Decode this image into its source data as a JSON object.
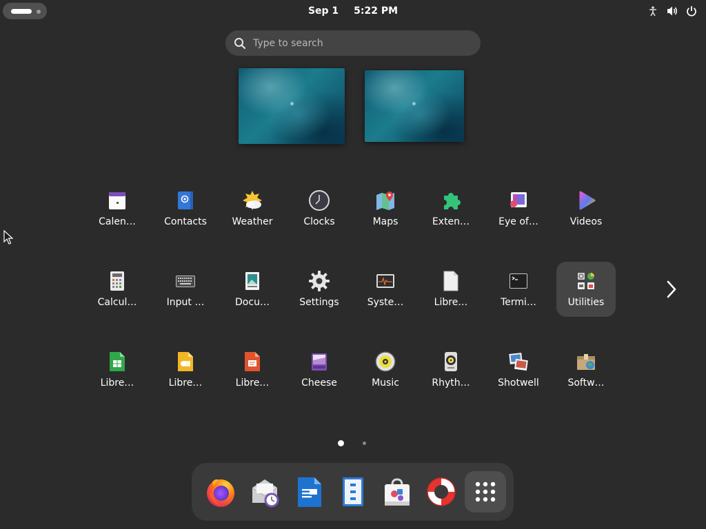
{
  "topbar": {
    "date": "Sep 1",
    "time": "5:22 PM",
    "status_icons": [
      "accessibility-icon",
      "volume-icon",
      "power-icon"
    ]
  },
  "search": {
    "placeholder": "Type to search"
  },
  "workspaces": [
    "workspace-1",
    "workspace-2"
  ],
  "app_grid": {
    "rows": [
      [
        {
          "label": "Calen…",
          "icon": "calendar-icon"
        },
        {
          "label": "Contacts",
          "icon": "contacts-icon"
        },
        {
          "label": "Weather",
          "icon": "weather-icon"
        },
        {
          "label": "Clocks",
          "icon": "clocks-icon"
        },
        {
          "label": "Maps",
          "icon": "maps-icon"
        },
        {
          "label": "Exten…",
          "icon": "extensions-icon"
        },
        {
          "label": "Eye of…",
          "icon": "image-viewer-icon"
        },
        {
          "label": "Videos",
          "icon": "videos-icon"
        }
      ],
      [
        {
          "label": "Calcul…",
          "icon": "calculator-icon"
        },
        {
          "label": "Input …",
          "icon": "keyboard-icon"
        },
        {
          "label": "Docu…",
          "icon": "document-viewer-icon"
        },
        {
          "label": "Settings",
          "icon": "settings-gear-icon"
        },
        {
          "label": "Syste…",
          "icon": "system-monitor-icon"
        },
        {
          "label": "Libre…",
          "icon": "libreoffice-icon"
        },
        {
          "label": "Termi…",
          "icon": "terminal-icon"
        },
        {
          "label": "Utilities",
          "icon": "utilities-folder-icon"
        }
      ],
      [
        {
          "label": "Libre…",
          "icon": "libreoffice-calc-icon"
        },
        {
          "label": "Libre…",
          "icon": "libreoffice-draw-icon"
        },
        {
          "label": "Libre…",
          "icon": "libreoffice-impress-icon"
        },
        {
          "label": "Cheese",
          "icon": "cheese-icon"
        },
        {
          "label": "Music",
          "icon": "music-icon"
        },
        {
          "label": "Rhyth…",
          "icon": "rhythmbox-icon"
        },
        {
          "label": "Shotwell",
          "icon": "shotwell-icon"
        },
        {
          "label": "Softw…",
          "icon": "software-icon"
        }
      ]
    ],
    "highlighted": "Utilities",
    "next_page_icon": "chevron-right-icon",
    "pages": 2,
    "current_page": 1
  },
  "dock": {
    "items": [
      "firefox-icon",
      "evolution-mail-icon",
      "libreoffice-writer-icon",
      "files-icon",
      "software-store-icon",
      "help-icon",
      "show-apps-icon"
    ]
  },
  "colors": {
    "background": "#2b2b2b",
    "search_bg": "#444444",
    "dock_bg": "#3a3a3a",
    "highlight_bg": "#454545"
  }
}
